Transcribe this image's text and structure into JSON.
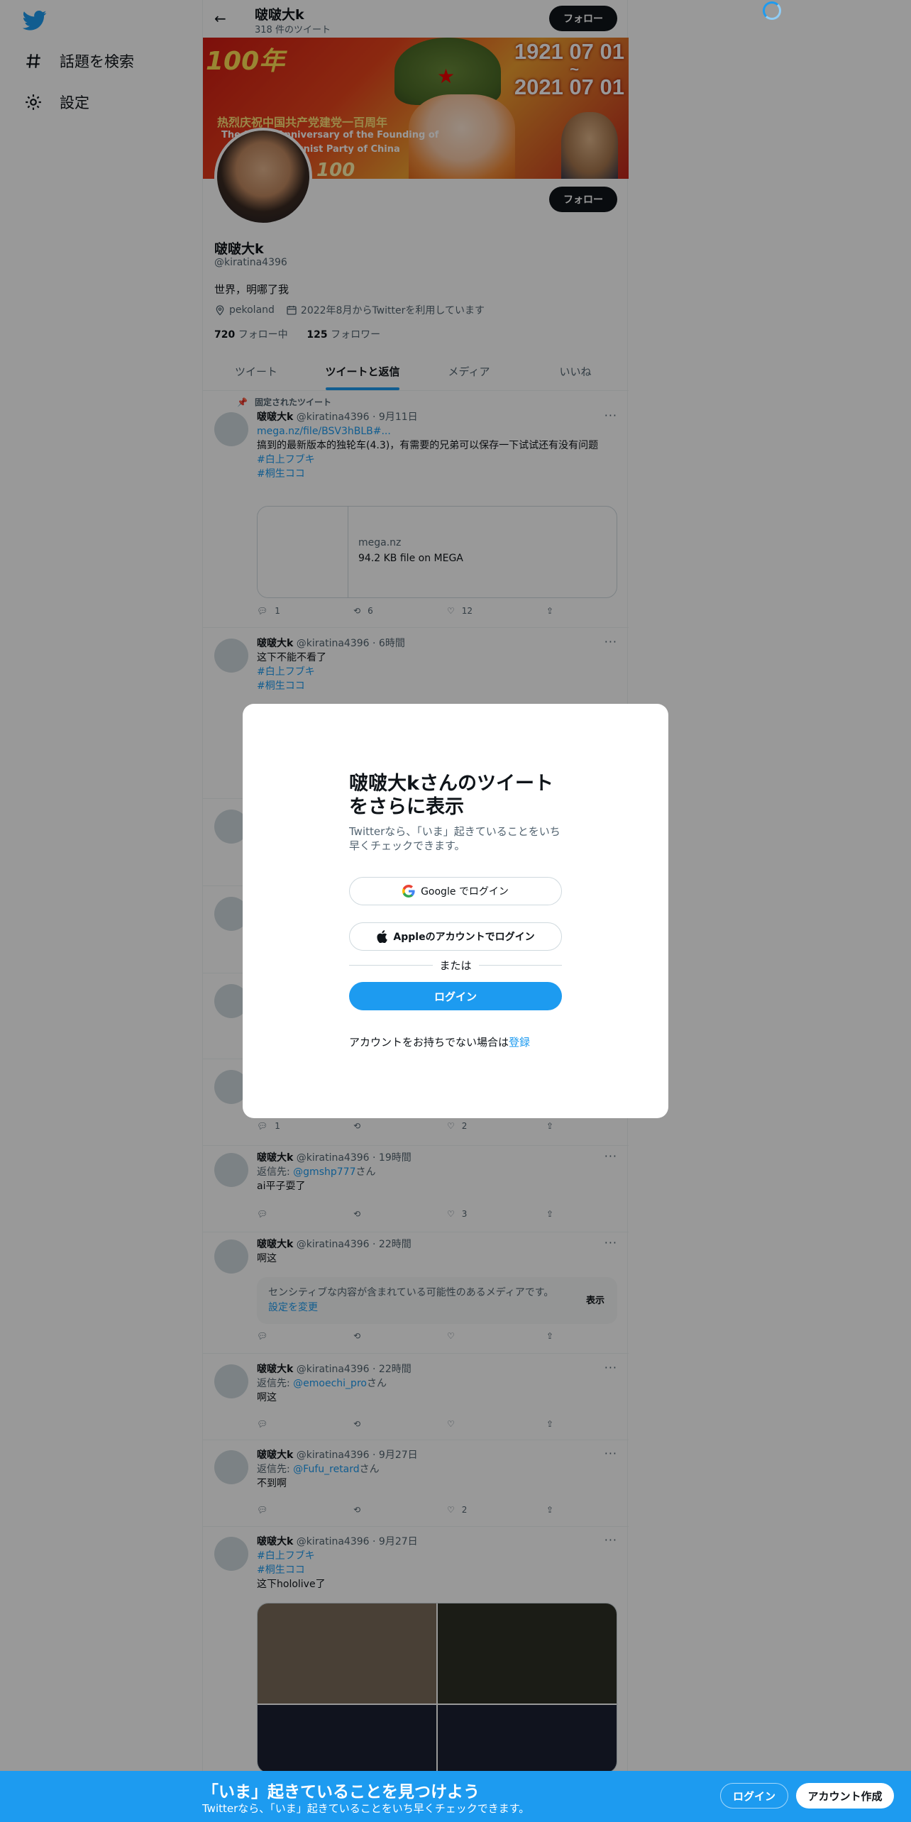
{
  "nav": {
    "logo": "twitter-bird-icon",
    "explore_label": "話題を検索",
    "settings_label": "設定"
  },
  "header": {
    "name": "啵啵大k",
    "tweet_count": "318 件のツイート",
    "follow_label": "フォロー"
  },
  "banner": {
    "date_top": "1921 07 01",
    "tilde": "~",
    "date_bottom": "2021 07 01",
    "line1": "热烈庆祝中国共产党建党一百周年",
    "line2": "The 100th Anniversary of the Founding of",
    "line3": "the Communist Party of China",
    "logo_text": "100年",
    "number": "100"
  },
  "profile": {
    "name": "啵啵大k",
    "handle": "@kiratina4396",
    "bio": "世界，明哪了我",
    "location": "pekoland",
    "joined": "2022年8月からTwitterを利用しています",
    "following_count": "720",
    "following_label": "フォロー中",
    "followers_count": "125",
    "followers_label": "フォロワー",
    "follow_label": "フォロー"
  },
  "tabs": [
    "ツイート",
    "ツイートと返信",
    "メディア",
    "いいね"
  ],
  "tweets": [
    {
      "pinned_label": "固定されたツイート",
      "name": "啵啵大k",
      "handle": "@kiratina4396",
      "time": "9月11日",
      "link": "mega.nz/file/BSV3hBLB#...",
      "text": "搞到的最新版本的独轮车(4.3)，有需要的兄弟可以保存一下试试还有没有问题",
      "tag1": "#白上フブキ",
      "tag2": "#桐生ココ",
      "card_domain": "mega.nz",
      "card_title": "94.2 KB file on MEGA",
      "replies": "1",
      "retweets": "6",
      "likes": "12"
    },
    {
      "name": "啵啵大k",
      "handle": "@kiratina4396",
      "time": "6時間",
      "text": "这下不能不看了",
      "tag1": "#白上フブキ",
      "tag2": "#桐生ココ"
    },
    {
      "replies": "1",
      "likes": "2"
    },
    {
      "name": "啵啵大k",
      "handle": "@kiratina4396",
      "time": "19時間",
      "reply_prefix": "返信先: ",
      "reply_to": "@gmshp777",
      "reply_suffix": "さん",
      "text": "ai平子耍了",
      "likes": "3"
    },
    {
      "name": "啵啵大k",
      "handle": "@kiratina4396",
      "time": "22時間",
      "text": "啊这",
      "sensitive_text": "センシティブな内容が含まれている可能性のあるメディアです。",
      "sensitive_link": "設定を変更",
      "show_label": "表示"
    },
    {
      "name": "啵啵大k",
      "handle": "@kiratina4396",
      "time": "22時間",
      "reply_prefix": "返信先: ",
      "reply_to": "@emoechi_pro",
      "reply_suffix": "さん",
      "text": "啊这"
    },
    {
      "name": "啵啵大k",
      "handle": "@kiratina4396",
      "time": "9月27日",
      "reply_prefix": "返信先: ",
      "reply_to": "@Fufu_retard",
      "reply_suffix": "さん",
      "text": "不到啊",
      "likes": "2"
    },
    {
      "name": "啵啵大k",
      "handle": "@kiratina4396",
      "time": "9月27日",
      "tag1": "#白上フブキ",
      "tag2": "#桐生ココ",
      "text": "这下hololive了"
    }
  ],
  "modal": {
    "title": "啵啵大kさんのツイートをさらに表示",
    "subtitle": "Twitterなら、「いま」起きていることをいち早くチェックできます。",
    "google_label": "Google でログイン",
    "apple_label": "Appleのアカウントでログイン",
    "or_label": "または",
    "login_label": "ログイン",
    "signup_prompt": "アカウントをお持ちでない場合は",
    "signup_link": "登録"
  },
  "bottom_bar": {
    "title": "「いま」起きていることを見つけよう",
    "subtitle": "Twitterなら、「いま」起きていることをいち早くチェックできます。",
    "login_label": "ログイン",
    "signup_label": "アカウント作成"
  },
  "colors": {
    "accent": "#1d9bf0",
    "text": "#0f1419",
    "secondary": "#536471"
  }
}
